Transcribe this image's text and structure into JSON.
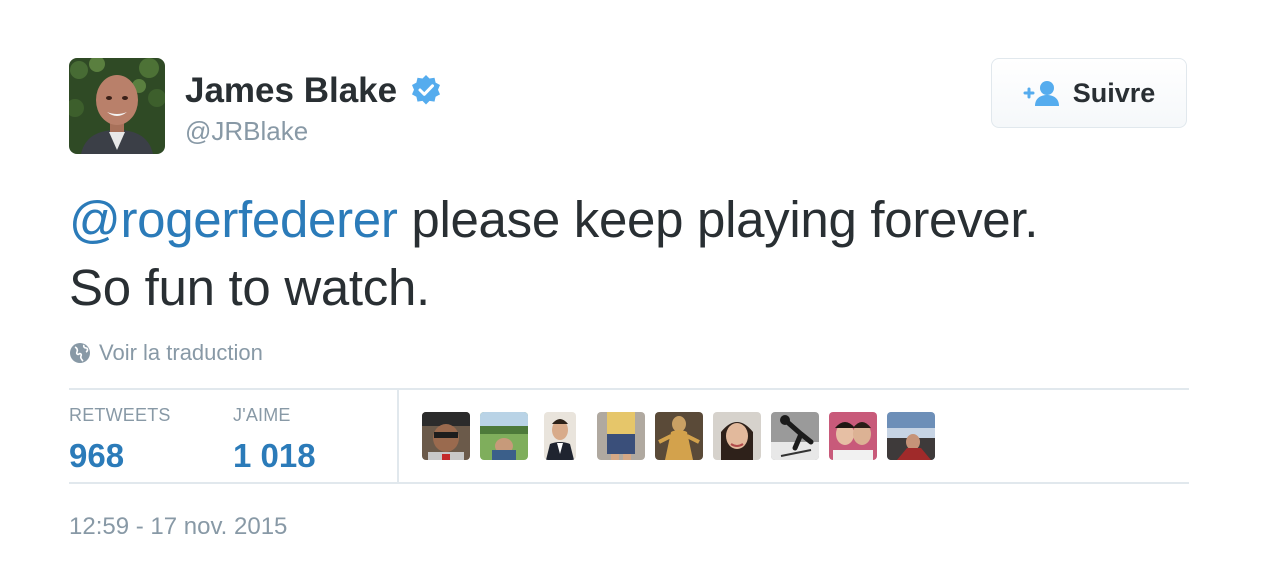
{
  "author": {
    "name": "James Blake",
    "handle": "@JRBlake",
    "verified": true
  },
  "follow_button": {
    "label": "Suivre",
    "icon": "add-user-icon"
  },
  "tweet": {
    "mention": "@rogerfederer",
    "text_line1": " please keep playing forever.",
    "text_line2": "So fun to watch."
  },
  "translate": {
    "label": "Voir la traduction",
    "icon": "globe-icon"
  },
  "stats": {
    "retweets_label": "RETWEETS",
    "retweets_value": "968",
    "likes_label": "J'AIME",
    "likes_value": "1 018"
  },
  "liker_avatars_count": 9,
  "timestamp": "12:59 - 17 nov. 2015",
  "colors": {
    "link": "#2b7bb9",
    "muted": "#8899a6",
    "text": "#292f33",
    "border": "#e1e8ed",
    "verified": "#55acee"
  }
}
